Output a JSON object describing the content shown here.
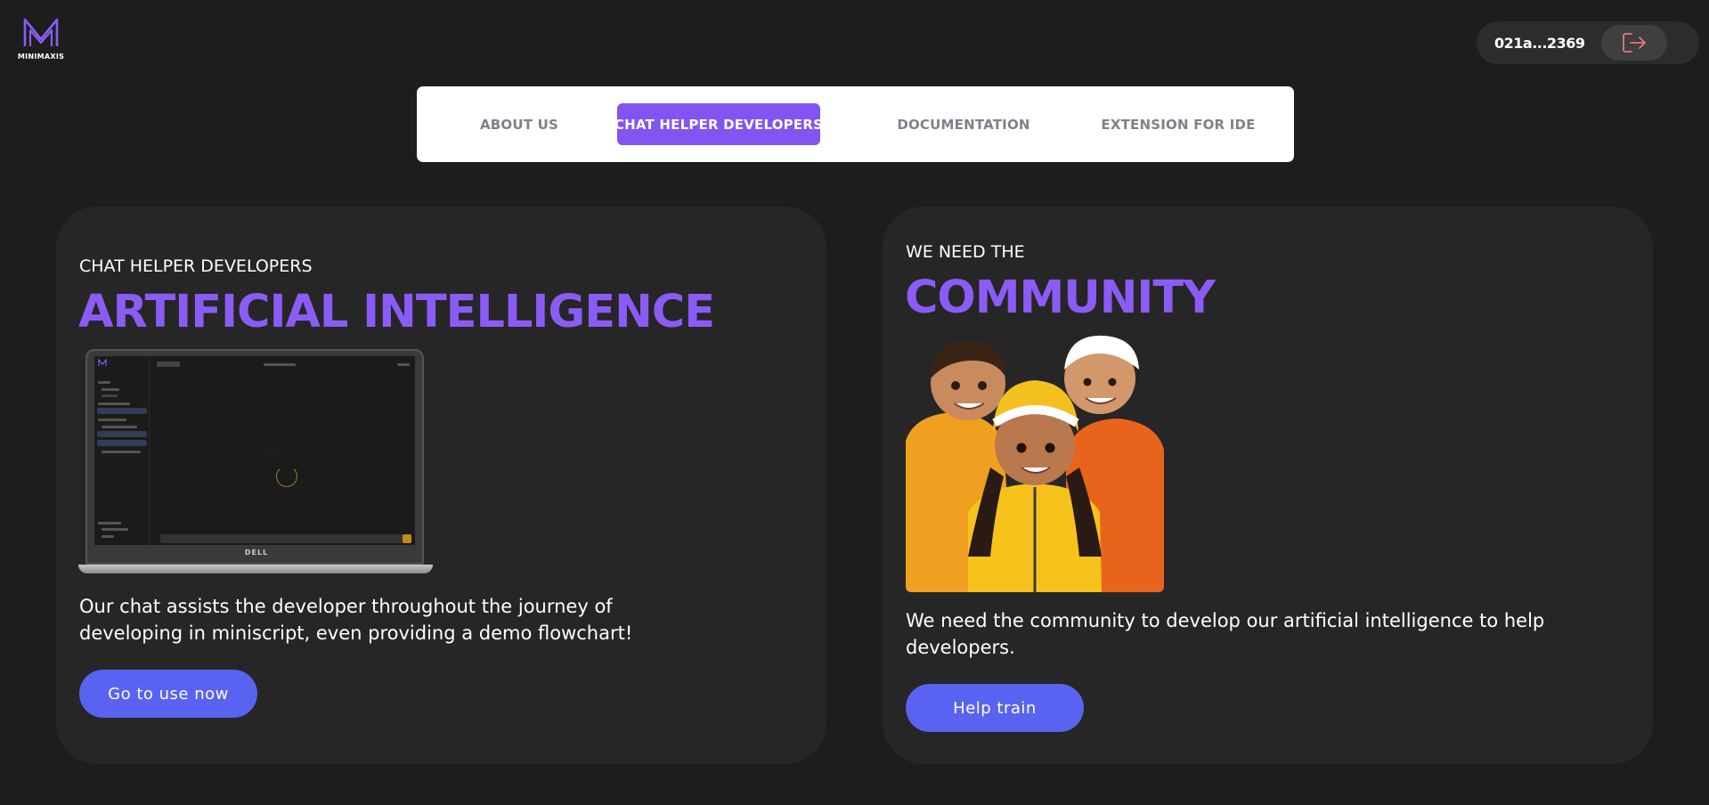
{
  "brand": {
    "name": "MINIMAXIS",
    "color": "#8a5cf5"
  },
  "account": {
    "id": "021a...2369",
    "logout_icon": "logout-icon"
  },
  "nav": {
    "items": [
      {
        "label": "ABOUT US",
        "active": false
      },
      {
        "label": "CHAT HELPER DEVELOPERS",
        "active": true
      },
      {
        "label": "DOCUMENTATION",
        "active": false
      },
      {
        "label": "EXTENSION FOR IDE",
        "active": false
      }
    ],
    "active_color": "#8254f1"
  },
  "cards": [
    {
      "eyebrow": "CHAT HELPER DEVELOPERS",
      "headline": "ARTIFICIAL INTELLIGENCE",
      "description": "Our chat assists the developer throughout the journey of developing in miniscript, even providing a demo flowchart!",
      "cta": "Go to use now",
      "illustration": {
        "brand": "DELL"
      }
    },
    {
      "eyebrow": "WE NEED THE",
      "headline": "COMMUNITY",
      "description": "We need the community to develop our artificial intelligence to help developers.",
      "cta": "Help train"
    }
  ],
  "colors": {
    "accent": "#8a5cf5",
    "button": "#5a62f1",
    "background": "#1d1d1d",
    "card": "#262626"
  }
}
